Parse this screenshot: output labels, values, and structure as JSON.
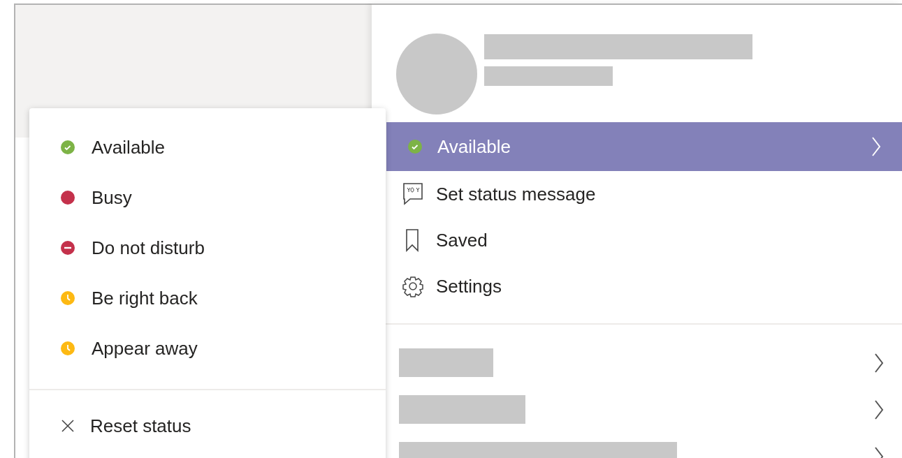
{
  "status_menu": {
    "items": [
      {
        "kind": "available",
        "label": "Available",
        "color": "#7db346"
      },
      {
        "kind": "busy",
        "label": "Busy",
        "color": "#c4314b"
      },
      {
        "kind": "dnd",
        "label": "Do not disturb",
        "color": "#c4314b"
      },
      {
        "kind": "brb",
        "label": "Be right back",
        "color": "#fdb913"
      },
      {
        "kind": "away",
        "label": "Appear away",
        "color": "#fdb913"
      }
    ],
    "reset": {
      "label": "Reset status"
    }
  },
  "profile_menu": {
    "current_status": {
      "kind": "available",
      "label": "Available",
      "color": "#7db346"
    },
    "items": [
      {
        "kind": "message",
        "label": "Set status message"
      },
      {
        "kind": "saved",
        "label": "Saved"
      },
      {
        "kind": "settings",
        "label": "Settings"
      }
    ]
  }
}
